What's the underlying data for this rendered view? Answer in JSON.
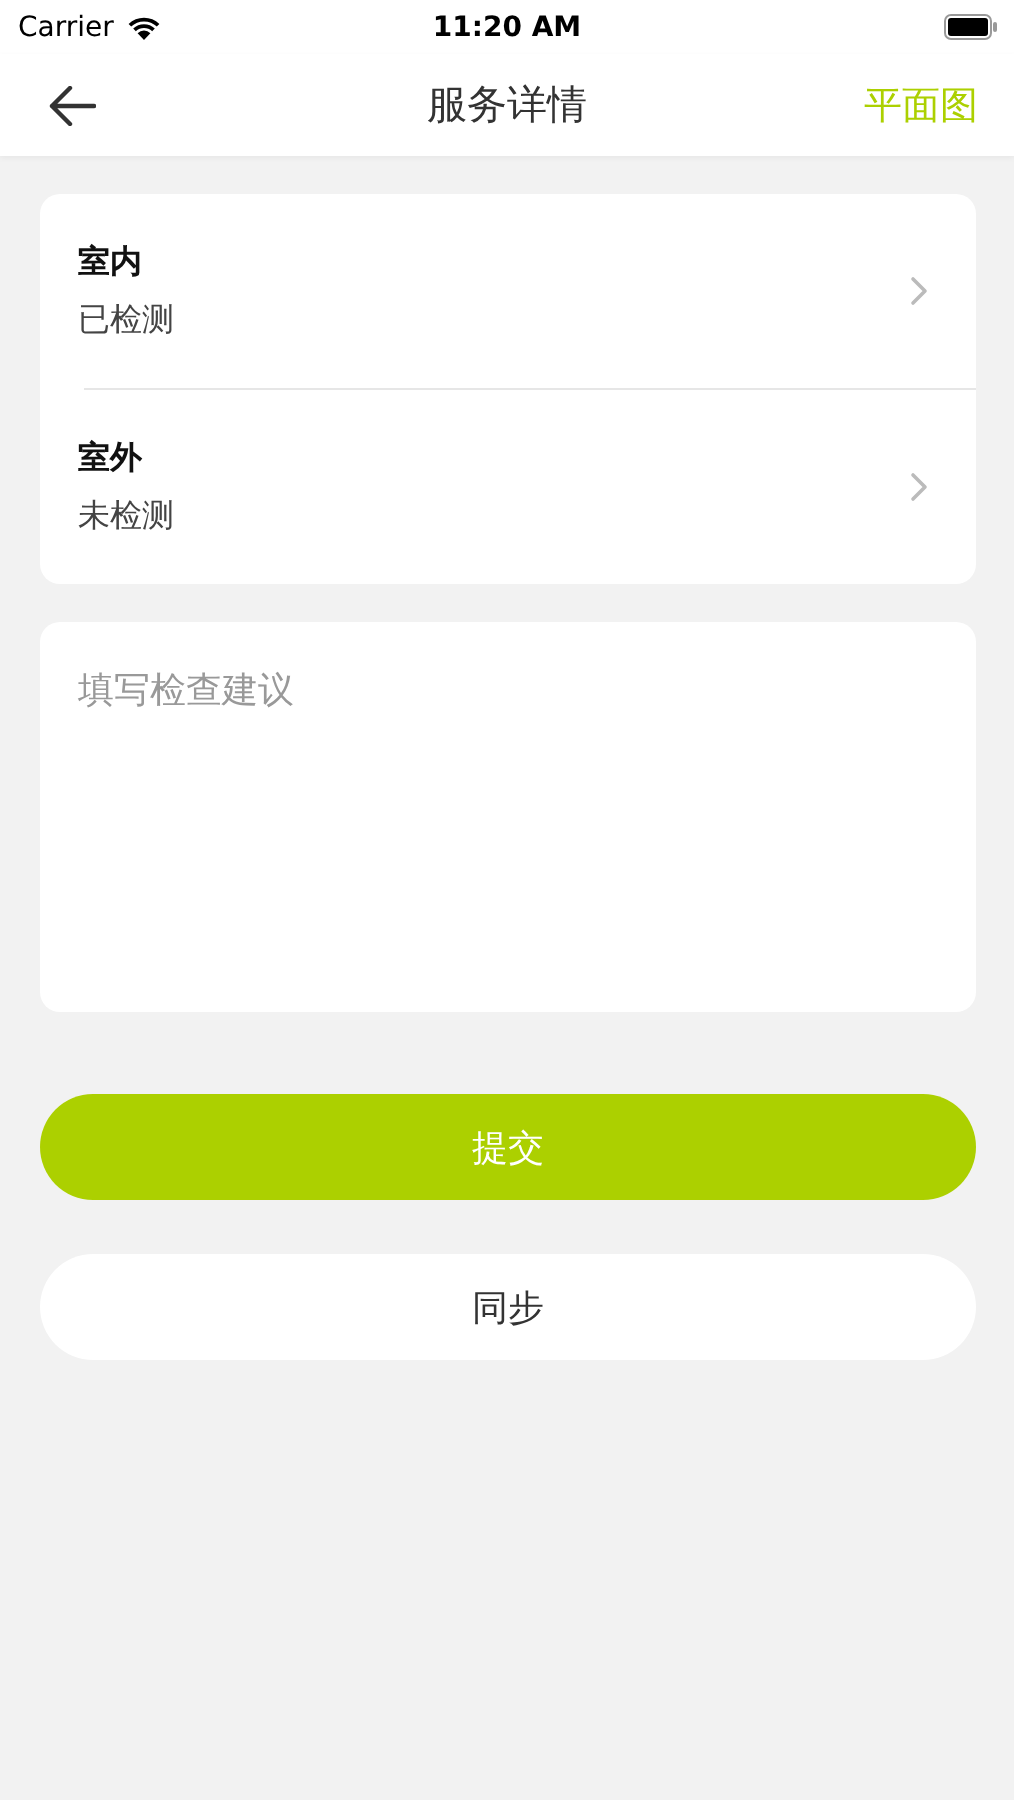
{
  "status_bar": {
    "carrier": "Carrier",
    "time": "11:20 AM"
  },
  "nav": {
    "title": "服务详情",
    "action": "平面图"
  },
  "areas": [
    {
      "name": "室内",
      "status": "已检测"
    },
    {
      "name": "室外",
      "status": "未检测"
    }
  ],
  "suggestion": {
    "placeholder": "填写检查建议"
  },
  "buttons": [
    {
      "label": "提交",
      "kind": "primary"
    },
    {
      "label": "同步",
      "kind": "secondary"
    }
  ]
}
